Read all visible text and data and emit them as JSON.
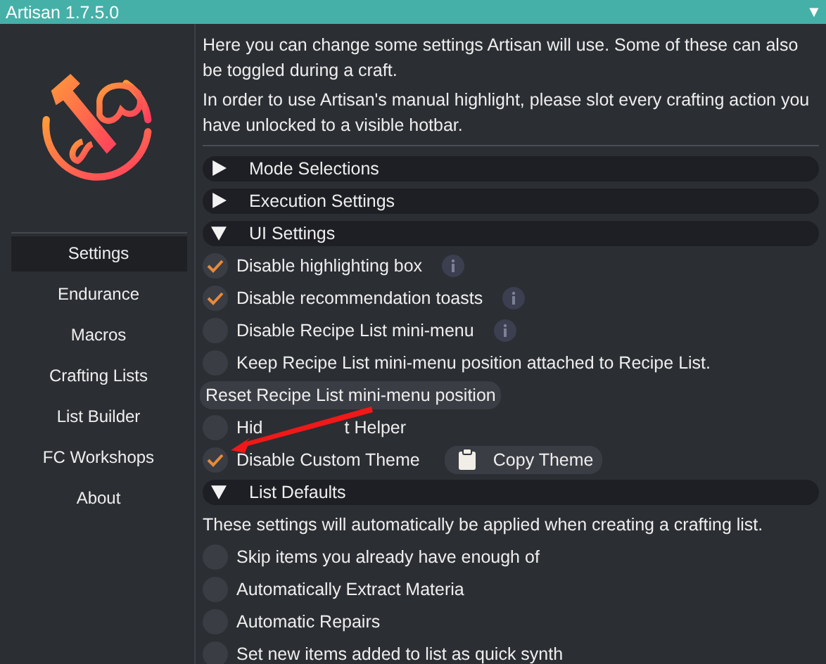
{
  "window": {
    "title": "Artisan 1.7.5.0",
    "collapse_glyph": "▼"
  },
  "sidebar": {
    "items": [
      {
        "label": "Settings",
        "selected": true
      },
      {
        "label": "Endurance",
        "selected": false
      },
      {
        "label": "Macros",
        "selected": false
      },
      {
        "label": "Crafting Lists",
        "selected": false
      },
      {
        "label": "List Builder",
        "selected": false
      },
      {
        "label": "FC Workshops",
        "selected": false
      },
      {
        "label": "About",
        "selected": false
      }
    ]
  },
  "intro": [
    "Here you can change some settings Artisan will use. Some of these can also be toggled during a craft.",
    "In order to use Artisan's manual highlight, please slot every crafting action you have unlocked to a visible hotbar."
  ],
  "rows": [
    {
      "kind": "header",
      "label": "Mode Selections",
      "expanded": false
    },
    {
      "kind": "header",
      "label": "Execution Settings",
      "expanded": false
    },
    {
      "kind": "header",
      "label": "UI Settings",
      "expanded": true
    },
    {
      "kind": "checkbox",
      "label": "Disable highlighting box",
      "checked": true,
      "info": true
    },
    {
      "kind": "checkbox",
      "label": "Disable recommendation toasts",
      "checked": true,
      "info": true
    },
    {
      "kind": "checkbox",
      "label": "Disable Recipe List mini-menu",
      "checked": false,
      "info": true
    },
    {
      "kind": "checkbox",
      "label": "Keep Recipe List mini-menu position attached to Recipe List.",
      "checked": false,
      "info": false
    },
    {
      "kind": "button",
      "label": "Reset Recipe List mini-menu position"
    },
    {
      "kind": "checkbox",
      "label": "Hid",
      "label_tail": "t Helper",
      "checked": false,
      "info": false
    },
    {
      "kind": "checkbox",
      "label": "Disable Custom Theme",
      "checked": true,
      "info": false,
      "button": "Copy Theme"
    },
    {
      "kind": "header",
      "label": "List Defaults",
      "expanded": true
    },
    {
      "kind": "text",
      "label": "These settings will automatically be applied when creating a crafting list."
    },
    {
      "kind": "checkbox",
      "label": "Skip items you already have enough of",
      "checked": false,
      "info": false
    },
    {
      "kind": "checkbox",
      "label": "Automatically Extract Materia",
      "checked": false,
      "info": false
    },
    {
      "kind": "checkbox",
      "label": "Automatic Repairs",
      "checked": false,
      "info": false
    },
    {
      "kind": "checkbox",
      "label": "Set new items added to list as quick synth",
      "checked": false,
      "info": false
    }
  ],
  "annotation": {
    "kind": "arrow"
  }
}
